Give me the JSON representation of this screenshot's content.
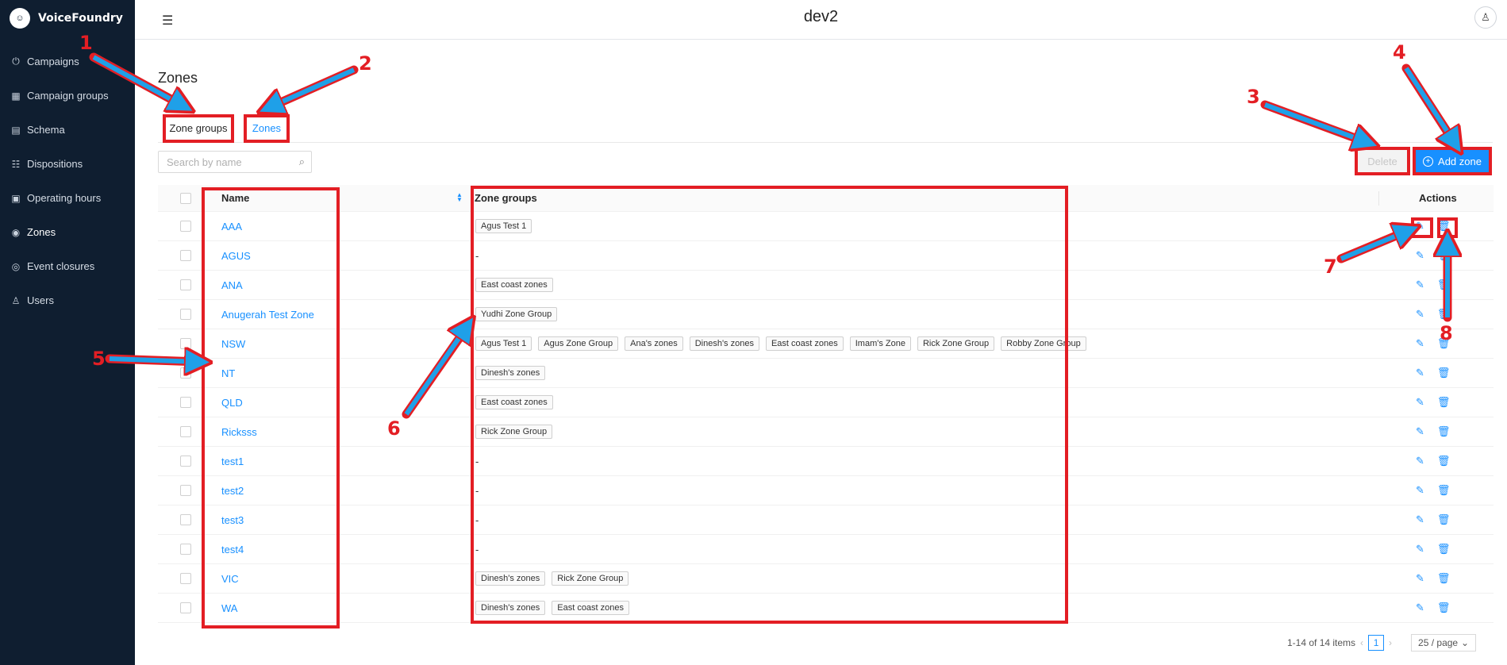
{
  "app": {
    "name": "VoiceFoundry",
    "env": "dev2"
  },
  "sidebar": {
    "items": [
      {
        "label": "Campaigns",
        "icon": "⏻"
      },
      {
        "label": "Campaign groups",
        "icon": "▦"
      },
      {
        "label": "Schema",
        "icon": "▤"
      },
      {
        "label": "Dispositions",
        "icon": "☷"
      },
      {
        "label": "Operating hours",
        "icon": "▣"
      },
      {
        "label": "Zones",
        "icon": "◉"
      },
      {
        "label": "Event closures",
        "icon": "◎"
      },
      {
        "label": "Users",
        "icon": "♙"
      }
    ]
  },
  "page": {
    "title": "Zones"
  },
  "tabs": {
    "zone_groups": "Zone groups",
    "zones": "Zones"
  },
  "search": {
    "placeholder": "Search by name"
  },
  "toolbar": {
    "delete_label": "Delete",
    "add_label": "Add zone"
  },
  "table": {
    "headers": {
      "name": "Name",
      "zone_groups": "Zone groups",
      "actions": "Actions"
    },
    "rows": [
      {
        "name": "AAA",
        "groups": [
          "Agus Test 1"
        ]
      },
      {
        "name": "AGUS",
        "groups": []
      },
      {
        "name": "ANA",
        "groups": [
          "East coast zones"
        ]
      },
      {
        "name": "Anugerah Test Zone",
        "groups": [
          "Yudhi Zone Group"
        ]
      },
      {
        "name": "NSW",
        "groups": [
          "Agus Test 1",
          "Agus Zone Group",
          "Ana's zones",
          "Dinesh's zones",
          "East coast zones",
          "Imam's Zone",
          "Rick Zone Group",
          "Robby Zone Group"
        ]
      },
      {
        "name": "NT",
        "groups": [
          "Dinesh's zones"
        ]
      },
      {
        "name": "QLD",
        "groups": [
          "East coast zones"
        ]
      },
      {
        "name": "Ricksss",
        "groups": [
          "Rick Zone Group"
        ]
      },
      {
        "name": "test1",
        "groups": []
      },
      {
        "name": "test2",
        "groups": []
      },
      {
        "name": "test3",
        "groups": []
      },
      {
        "name": "test4",
        "groups": []
      },
      {
        "name": "VIC",
        "groups": [
          "Dinesh's zones",
          "Rick Zone Group"
        ]
      },
      {
        "name": "WA",
        "groups": [
          "Dinesh's zones",
          "East coast zones"
        ]
      }
    ],
    "empty_value": "-"
  },
  "pagination": {
    "summary": "1-14 of 14 items",
    "current_page": "1",
    "page_size": "25 / page"
  },
  "annotations": [
    "1",
    "2",
    "3",
    "4",
    "5",
    "6",
    "7",
    "8"
  ],
  "colors": {
    "accent": "#1890ff",
    "sidebar": "#0f1e30",
    "annotation": "#e31e24",
    "arrow": "#1fa0e8"
  }
}
